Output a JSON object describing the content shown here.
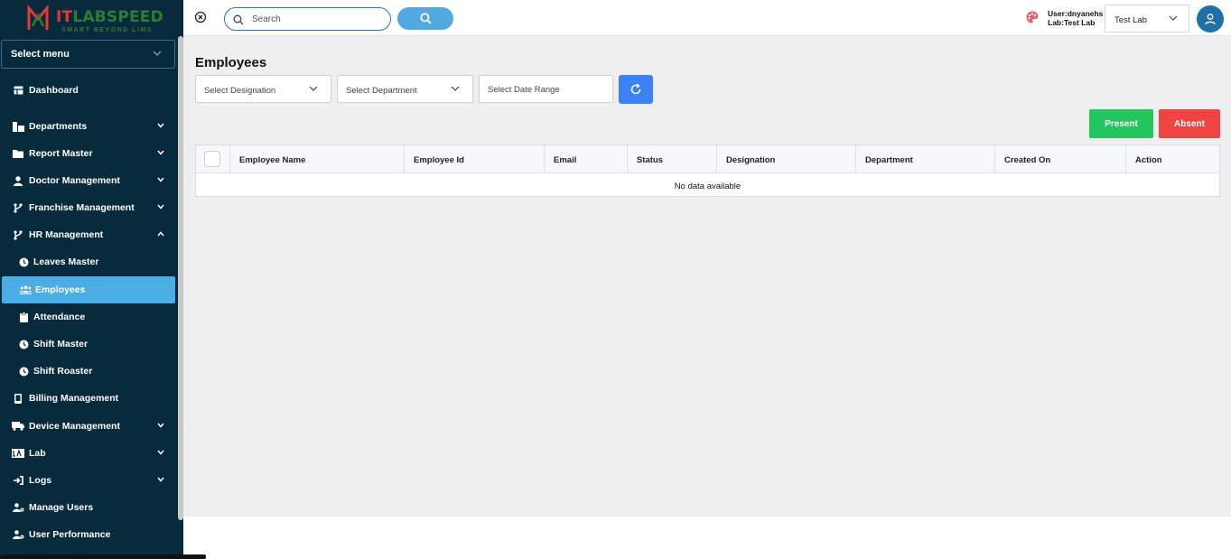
{
  "brand": {
    "name_prefix": "IT",
    "name_rest": "LABSPEED",
    "tagline": "SMART BEYOND LIMS"
  },
  "sidebar": {
    "select_menu_label": "Select menu",
    "items": [
      {
        "label": "Dashboard",
        "icon": "dashboard-icon",
        "expandable": false
      },
      {
        "label": "Departments",
        "icon": "departments-icon",
        "expandable": true
      },
      {
        "label": "Report Master",
        "icon": "folder-icon",
        "expandable": true
      },
      {
        "label": "Doctor Management",
        "icon": "user-icon",
        "expandable": true
      },
      {
        "label": "Franchise Management",
        "icon": "branch-icon",
        "expandable": true
      },
      {
        "label": "HR Management",
        "icon": "branch-icon",
        "expandable": true,
        "expanded": true
      }
    ],
    "hr_subitems": [
      {
        "label": "Leaves Master",
        "icon": "clock-icon"
      },
      {
        "label": "Employees",
        "icon": "people-icon",
        "active": true
      },
      {
        "label": "Attendance",
        "icon": "clipboard-icon"
      },
      {
        "label": "Shift Master",
        "icon": "clock-icon"
      },
      {
        "label": "Shift Roaster",
        "icon": "clock-icon"
      }
    ],
    "bottom_items": [
      {
        "label": "Billing Management",
        "icon": "mobile-icon",
        "expandable": false
      },
      {
        "label": "Device Management",
        "icon": "truck-icon",
        "expandable": true
      },
      {
        "label": "Lab",
        "icon": "lab-icon",
        "expandable": true
      },
      {
        "label": "Logs",
        "icon": "login-icon",
        "expandable": true
      },
      {
        "label": "Manage Users",
        "icon": "user-gear-icon",
        "expandable": false
      },
      {
        "label": "User Performance",
        "icon": "user-gear-icon",
        "expandable": false
      }
    ]
  },
  "topbar": {
    "search_placeholder": "Search",
    "user_line": "User:dnyanehs",
    "lab_line": "Lab:Test Lab",
    "lab_selected": "Test Lab"
  },
  "main": {
    "title": "Employees",
    "filters": {
      "designation_placeholder": "Select Designation",
      "department_placeholder": "Select Department",
      "date_range_placeholder": "Select Date Range"
    },
    "present_label": "Present",
    "absent_label": "Absent",
    "table": {
      "columns": [
        "Employee Name",
        "Employee Id",
        "Email",
        "Status",
        "Designation",
        "Department",
        "Created On",
        "Action"
      ],
      "empty_message": "No data available"
    }
  },
  "colors": {
    "sidebar_bg": "#082a3d",
    "active_item": "#4aaee5",
    "present": "#22c55e",
    "absent": "#ef4444",
    "refresh": "#3b82f6"
  }
}
